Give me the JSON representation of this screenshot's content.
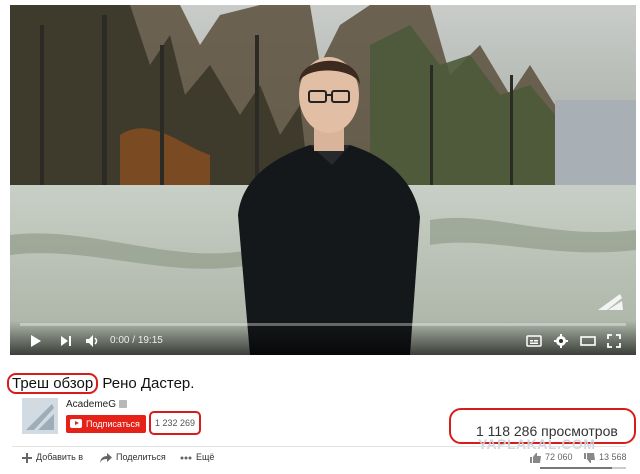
{
  "player": {
    "time_current": "0:00",
    "time_separator": "/",
    "time_total": "19:15",
    "progress": 0
  },
  "video": {
    "title_highlighted": "Треш обзор",
    "title_rest": " Рено Дастер."
  },
  "channel": {
    "name": "AcademeG",
    "subscribe_label": "Подписаться",
    "subscriber_count": "1 232 269"
  },
  "stats": {
    "views": "1 118 286 просмотров",
    "likes": "72 060",
    "dislikes": "13 568",
    "like_ratio": 0.84
  },
  "actions": {
    "add_to": "Добавить в",
    "share": "Поделиться",
    "more": "Ещё"
  },
  "watermark": "YAPLAKAL.COM",
  "colors": {
    "highlight": "#d81c1c",
    "subscribe": "#e62117"
  }
}
